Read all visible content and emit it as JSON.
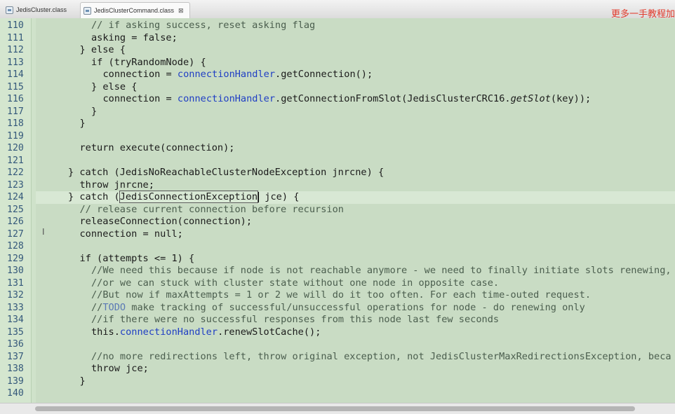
{
  "tabs": [
    {
      "label": "JedisCluster.class",
      "icon": "class-file-icon",
      "close": ""
    },
    {
      "label": "JedisClusterCommand.class",
      "icon": "class-file-icon",
      "close": "⊠"
    }
  ],
  "watermark": "更多一手教程加",
  "editor": {
    "cursor_line": 124,
    "lines": [
      {
        "n": "110",
        "indent": 4,
        "tokens": [
          [
            "cm",
            "// if asking success, reset asking flag"
          ]
        ]
      },
      {
        "n": "111",
        "indent": 4,
        "tokens": [
          [
            "",
            "asking = false;"
          ]
        ]
      },
      {
        "n": "112",
        "indent": 3,
        "tokens": [
          [
            "",
            "} else {"
          ]
        ]
      },
      {
        "n": "113",
        "indent": 4,
        "tokens": [
          [
            "",
            "if (tryRandomNode) {"
          ]
        ]
      },
      {
        "n": "114",
        "indent": 5,
        "tokens": [
          [
            "",
            "connection = "
          ],
          [
            "fld",
            "connectionHandler"
          ],
          [
            "",
            ".getConnection();"
          ]
        ]
      },
      {
        "n": "115",
        "indent": 4,
        "tokens": [
          [
            "",
            "} else {"
          ]
        ]
      },
      {
        "n": "116",
        "indent": 5,
        "tokens": [
          [
            "",
            "connection = "
          ],
          [
            "fld",
            "connectionHandler"
          ],
          [
            "",
            ".getConnectionFromSlot(JedisClusterCRC16."
          ],
          [
            "it",
            "getSlot"
          ],
          [
            "",
            "(key));"
          ]
        ]
      },
      {
        "n": "117",
        "indent": 4,
        "tokens": [
          [
            "",
            "}"
          ]
        ]
      },
      {
        "n": "118",
        "indent": 3,
        "tokens": [
          [
            "",
            "}"
          ]
        ]
      },
      {
        "n": "119",
        "indent": 0,
        "tokens": []
      },
      {
        "n": "120",
        "indent": 3,
        "tokens": [
          [
            "",
            "return execute(connection);"
          ]
        ]
      },
      {
        "n": "121",
        "indent": 0,
        "tokens": []
      },
      {
        "n": "122",
        "indent": 2,
        "tokens": [
          [
            "",
            "} catch (JedisNoReachableClusterNodeException jnrcne) {"
          ]
        ]
      },
      {
        "n": "123",
        "indent": 3,
        "tokens": [
          [
            "",
            "throw jnrcne;"
          ]
        ]
      },
      {
        "n": "124",
        "indent": 2,
        "tokens": [
          [
            "",
            "} catch ("
          ],
          [
            "sel",
            "JedisConnectionException"
          ],
          [
            "caret",
            ""
          ],
          [
            "",
            "",
            " jce) {"
          ]
        ]
      },
      {
        "n": "125",
        "indent": 3,
        "tokens": [
          [
            "cm",
            "// release current connection before recursion"
          ]
        ]
      },
      {
        "n": "126",
        "indent": 3,
        "tokens": [
          [
            "",
            "releaseConnection(connection);"
          ]
        ]
      },
      {
        "n": "127",
        "indent": 3,
        "tokens": [
          [
            "",
            "connection = null;"
          ]
        ]
      },
      {
        "n": "128",
        "indent": 0,
        "tokens": []
      },
      {
        "n": "129",
        "indent": 3,
        "tokens": [
          [
            "",
            "if (attempts <= 1) {"
          ]
        ]
      },
      {
        "n": "130",
        "indent": 4,
        "tokens": [
          [
            "cm",
            "//We need this because if node is not reachable anymore - we need to finally initiate slots renewing,"
          ]
        ]
      },
      {
        "n": "131",
        "indent": 4,
        "tokens": [
          [
            "cm",
            "//or we can stuck with cluster state without one node in opposite case."
          ]
        ]
      },
      {
        "n": "132",
        "indent": 4,
        "tokens": [
          [
            "cm",
            "//But now if maxAttempts = 1 or 2 we will do it too often. For each time-outed request."
          ]
        ]
      },
      {
        "n": "133",
        "indent": 4,
        "tokens": [
          [
            "cm",
            "//"
          ],
          [
            "todo",
            "TODO"
          ],
          [
            "cm",
            " make tracking of successful/unsuccessful operations for node - do renewing only"
          ]
        ]
      },
      {
        "n": "134",
        "indent": 4,
        "tokens": [
          [
            "cm",
            "//if there were no successful responses from this node last few seconds"
          ]
        ]
      },
      {
        "n": "135",
        "indent": 4,
        "tokens": [
          [
            "",
            "this."
          ],
          [
            "fld",
            "connectionHandler"
          ],
          [
            "",
            ".renewSlotCache();"
          ]
        ]
      },
      {
        "n": "136",
        "indent": 0,
        "tokens": []
      },
      {
        "n": "137",
        "indent": 4,
        "tokens": [
          [
            "cm",
            "//no more redirections left, throw original exception, not JedisClusterMaxRedirectionsException, beca"
          ]
        ]
      },
      {
        "n": "138",
        "indent": 4,
        "tokens": [
          [
            "",
            "throw jce;"
          ]
        ]
      },
      {
        "n": "139",
        "indent": 3,
        "tokens": [
          [
            "",
            "}"
          ]
        ]
      },
      {
        "n": "140",
        "indent": 0,
        "tokens": []
      }
    ]
  }
}
